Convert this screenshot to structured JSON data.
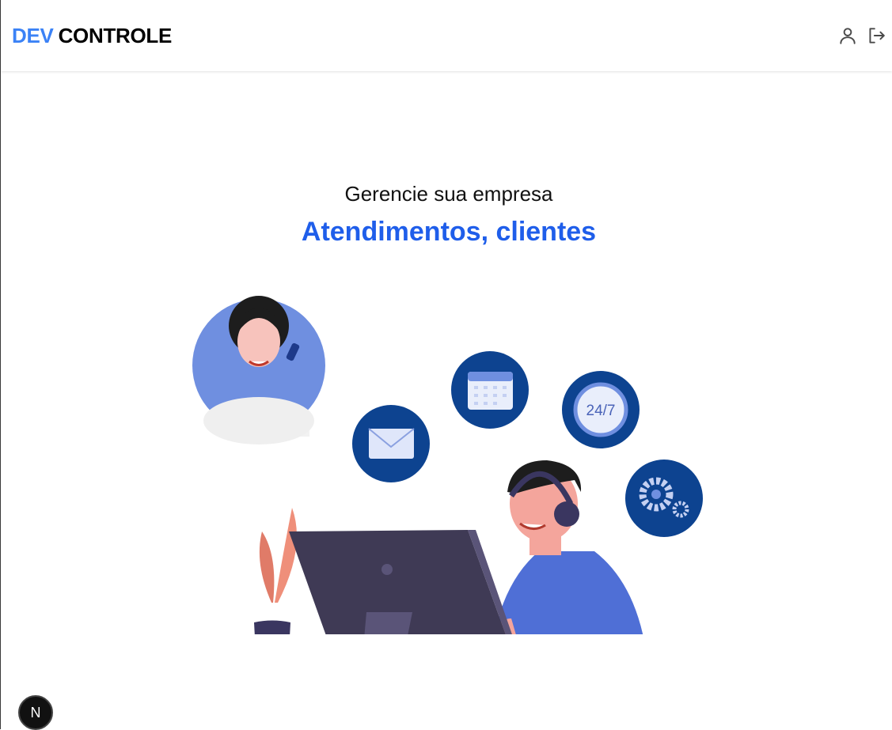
{
  "header": {
    "logo_dev": "DEV",
    "logo_controle": "CONTROLE",
    "icons": [
      "user-icon",
      "logout-icon"
    ]
  },
  "hero": {
    "subtitle": "Gerencie sua empresa",
    "title": "Atendimentos, clientes",
    "calendar_text": "24/7"
  },
  "badge": {
    "letter": "N"
  },
  "colors": {
    "accent": "#3b82f6",
    "title": "#1f5eea",
    "bubble": "#0d4390",
    "shirt": "#4f6fd6"
  }
}
